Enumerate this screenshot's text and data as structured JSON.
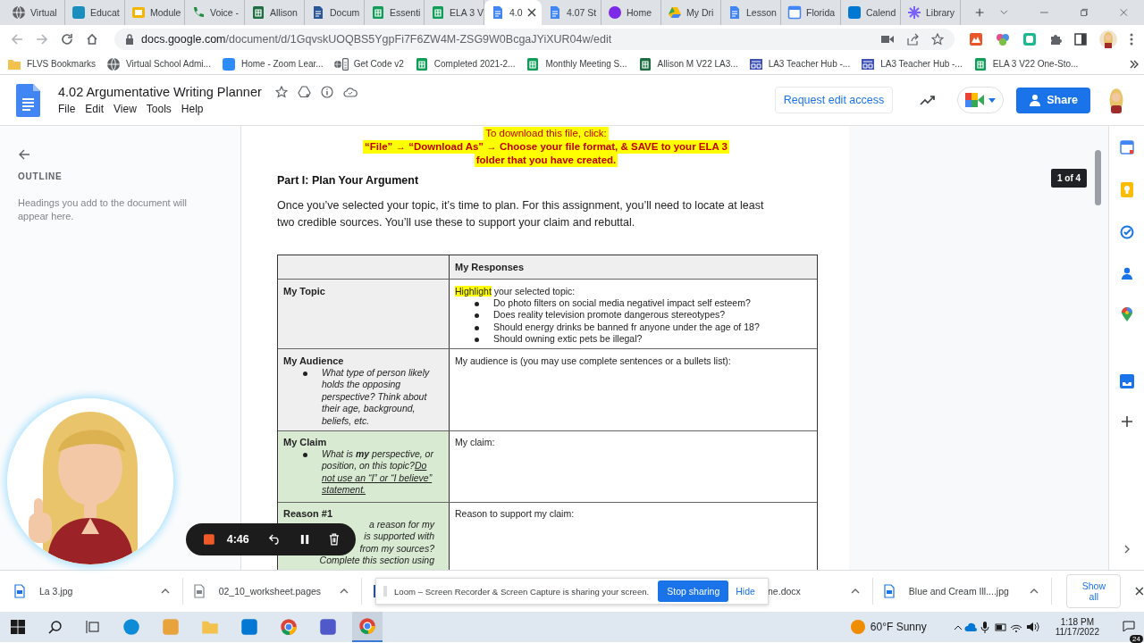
{
  "browser": {
    "tabs": [
      {
        "kind": "globe",
        "label": "Virtual",
        "selected": false
      },
      {
        "kind": "person",
        "label": "Educat",
        "selected": false
      },
      {
        "kind": "slides",
        "label": "Module",
        "selected": false
      },
      {
        "kind": "phone",
        "label": "Voice -",
        "selected": false
      },
      {
        "kind": "excel",
        "label": "Allison",
        "selected": false
      },
      {
        "kind": "word",
        "label": "Docum",
        "selected": false
      },
      {
        "kind": "sheets",
        "label": "Essenti",
        "selected": false
      },
      {
        "kind": "sheets",
        "label": "ELA 3 V",
        "selected": false
      },
      {
        "kind": "docs",
        "label": "4.0",
        "selected": true
      },
      {
        "kind": "docs",
        "label": "4.07 St",
        "selected": false
      },
      {
        "kind": "canva",
        "label": "Home",
        "selected": false
      },
      {
        "kind": "drive",
        "label": "My Dri",
        "selected": false
      },
      {
        "kind": "docs",
        "label": "Lesson",
        "selected": false
      },
      {
        "kind": "calendar",
        "label": "Florida",
        "selected": false
      },
      {
        "kind": "outlook",
        "label": "Calend",
        "selected": false
      },
      {
        "kind": "flower",
        "label": "Library",
        "selected": false
      }
    ],
    "url_host": "docs.google.com",
    "url_path": "/document/d/1GqvskUOQBS5YgpFi7F6ZW4M-ZSG9W0BcgaJYiXUR04w/edit",
    "bookmarks": [
      {
        "kind": "folder",
        "label": "FLVS Bookmarks"
      },
      {
        "kind": "globe",
        "label": "Virtual School Admi..."
      },
      {
        "kind": "zoom",
        "label": "Home - Zoom Lear..."
      },
      {
        "kind": "code",
        "label": "Get Code v2"
      },
      {
        "kind": "sheets",
        "label": "Completed 2021-2..."
      },
      {
        "kind": "sheets",
        "label": "Monthly Meeting S..."
      },
      {
        "kind": "excel",
        "label": "Allison M V22 LA3..."
      },
      {
        "kind": "board",
        "label": "LA3 Teacher Hub -..."
      },
      {
        "kind": "board",
        "label": "LA3 Teacher Hub -..."
      },
      {
        "kind": "sheets",
        "label": "ELA 3 V22 One-Sto..."
      }
    ]
  },
  "docs": {
    "title": "4.02 Argumentative Writing Planner",
    "menu": [
      "File",
      "Edit",
      "View",
      "Tools",
      "Help"
    ],
    "request_button": "Request edit access",
    "share_button": "Share"
  },
  "outline": {
    "title": "OUTLINE",
    "hint": "Headings you add to the document will appear here."
  },
  "document": {
    "download_notice": [
      "To download this file, click:",
      "“File” → “Download As” → Choose your file format, & SAVE to your ELA 3",
      "folder that you have created."
    ],
    "heading": "Part I: Plan Your Argument",
    "intro": "Once you’ve selected your topic, it’s time to plan. For this assignment, you’ll need to locate at least two credible sources. You’ll use these to support your claim and rebuttal.",
    "table": {
      "column_2": "My Responses",
      "rows": [
        {
          "label": "My Topic",
          "color": "#efefef",
          "prompts": [],
          "response": {
            "highlight": "Highlight",
            "text": "your selected topic:",
            "bullets": [
              "Do photo filters on social media negativel impact self esteem?",
              "Does reality television promote dangerous stereotypes?",
              "Should energy drinks be banned fr anyone under the age of 18?",
              "Should owning extic pets be illegal?"
            ]
          }
        },
        {
          "label": "My Audience",
          "color": "#efefef",
          "prompts": [
            {
              "text": "What type of person likely holds the opposing perspective? Think about their age, background, beliefs, etc."
            }
          ],
          "response": {
            "text": "My audience is (you may use complete sentences or a bullets list):"
          }
        },
        {
          "label": "My Claim",
          "color": "#d9ead3",
          "prompts": [
            {
              "text": "What is **my** perspective, or position, on this topic?",
              "underlined": "Do not use an “I” or “I believe” statement."
            }
          ],
          "response": {
            "text": "My claim:"
          }
        },
        {
          "label": "Reason #1",
          "color": "#d9ead3",
          "fragments": [
            "a reason for my",
            "is supported with",
            "from my sources?",
            "Complete this section using"
          ],
          "response": {
            "text": "Reason to support my claim:"
          }
        }
      ]
    }
  },
  "page_indicator": "1 of 4",
  "downloads": {
    "items": [
      {
        "label": "La 3.jpg"
      },
      {
        "kind": "pages",
        "label": "02_10_worksheet.pages"
      },
      {
        "kind": "word",
        "label": "ne.docx"
      },
      {
        "label": "Blue and Cream Ill....jpg"
      }
    ],
    "show_all": "Show all"
  },
  "loom": {
    "timer": "4:46",
    "notice": "Loom – Screen Recorder & Screen Capture is sharing your screen.",
    "stop_button": "Stop sharing",
    "hide_link": "Hide"
  },
  "taskbar": {
    "apps": [
      {
        "kind": "edge",
        "selected": false
      },
      {
        "kind": "store",
        "selected": false
      },
      {
        "kind": "folder",
        "selected": false
      },
      {
        "kind": "outlook",
        "selected": false
      },
      {
        "kind": "chrome",
        "selected": false
      },
      {
        "kind": "teams",
        "selected": false
      },
      {
        "kind": "chrome",
        "selected": true
      }
    ],
    "weather": "60°F Sunny",
    "time": "1:18 PM",
    "date": "11/17/2022",
    "notifications": "24"
  }
}
